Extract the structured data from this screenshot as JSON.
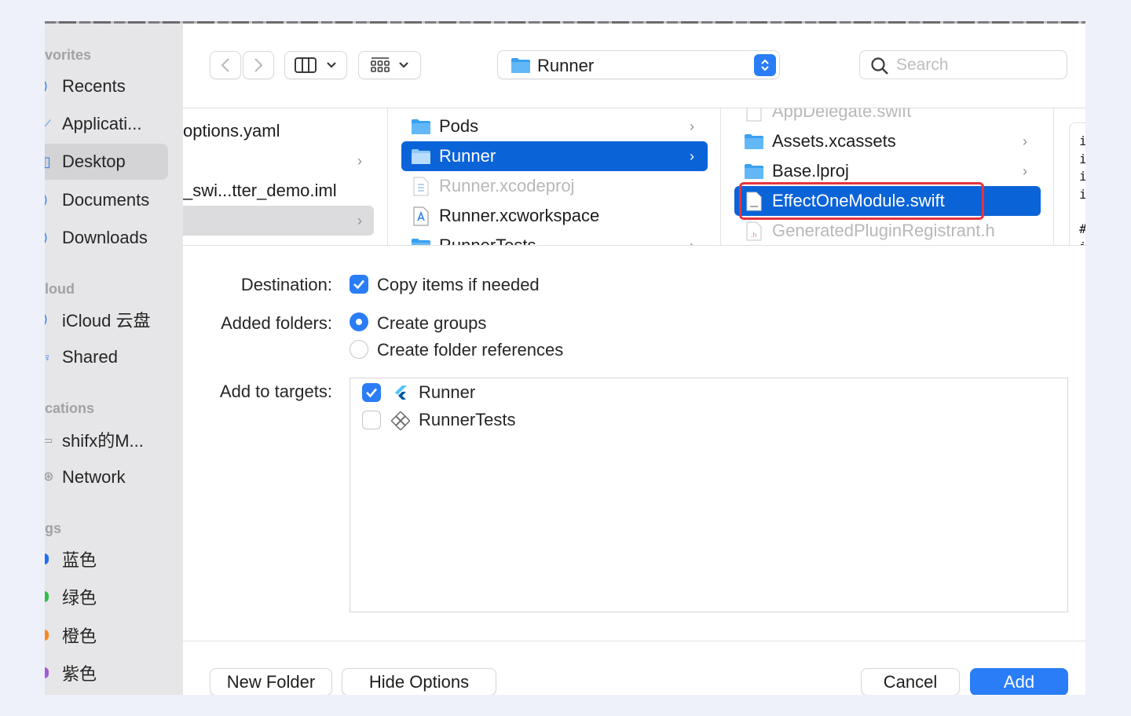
{
  "sidebar": {
    "sections": [
      {
        "title": "vorites",
        "items": [
          {
            "label": "Recents",
            "icon": "clock-icon"
          },
          {
            "label": "Applicati...",
            "icon": "applications-icon"
          },
          {
            "label": "Desktop",
            "icon": "desktop-icon",
            "selected": true
          },
          {
            "label": "Documents",
            "icon": "document-icon"
          },
          {
            "label": "Downloads",
            "icon": "download-icon"
          }
        ]
      },
      {
        "title": "loud",
        "items": [
          {
            "label": "iCloud 云盘",
            "icon": "cloud-icon"
          },
          {
            "label": "Shared",
            "icon": "shared-folder-icon"
          }
        ]
      },
      {
        "title": "cations",
        "items": [
          {
            "label": "shifx的M...",
            "icon": "computer-icon"
          },
          {
            "label": "Network",
            "icon": "network-icon"
          }
        ]
      },
      {
        "title": "gs",
        "items": [
          {
            "label": "蓝色",
            "color": "#1f6ff5"
          },
          {
            "label": "绿色",
            "color": "#2fbf4b"
          },
          {
            "label": "橙色",
            "color": "#f58a1f"
          },
          {
            "label": "紫色",
            "color": "#a05ad6"
          }
        ]
      }
    ]
  },
  "toolbar": {
    "path_label": "Runner",
    "search_placeholder": "Search"
  },
  "browser": {
    "col1": [
      {
        "label": "options.yaml"
      },
      {
        "label": "",
        "chevron": true
      },
      {
        "label": "_swi...tter_demo.iml"
      },
      {
        "label": "",
        "chevron": true,
        "selected_inactive": true
      }
    ],
    "col2": [
      {
        "label": "Pods",
        "type": "folder",
        "chevron": true
      },
      {
        "label": "Runner",
        "type": "folder",
        "chevron": true,
        "selected": true
      },
      {
        "label": "Runner.xcodeproj",
        "type": "xcodeproj",
        "dim": true
      },
      {
        "label": "Runner.xcworkspace",
        "type": "xcworkspace"
      },
      {
        "label": "RunnerTests",
        "type": "folder",
        "chevron": true
      }
    ],
    "col3": [
      {
        "label": "AppDelegate.swift",
        "type": "swift",
        "dim": true
      },
      {
        "label": "Assets.xcassets",
        "type": "folder",
        "chevron": true
      },
      {
        "label": "Base.lproj",
        "type": "folder",
        "chevron": true
      },
      {
        "label": "EffectOneModule.swift",
        "type": "swift",
        "selected": true
      },
      {
        "label": "GeneratedPluginRegistrant.h",
        "type": "header",
        "dim": true
      }
    ],
    "preview_chars": [
      "i",
      "i",
      "i",
      "i",
      "",
      "#",
      "i"
    ]
  },
  "options": {
    "destination_label": "Destination:",
    "copy_items_label": "Copy items if needed",
    "added_folders_label": "Added folders:",
    "create_groups_label": "Create groups",
    "create_refs_label": "Create folder references",
    "add_targets_label": "Add to targets:",
    "targets": [
      {
        "label": "Runner",
        "checked": true,
        "icon": "flutter-icon"
      },
      {
        "label": "RunnerTests",
        "checked": false,
        "icon": "test-bundle-icon"
      }
    ]
  },
  "footer": {
    "new_folder": "New Folder",
    "hide_options": "Hide Options",
    "cancel": "Cancel",
    "add": "Add"
  }
}
